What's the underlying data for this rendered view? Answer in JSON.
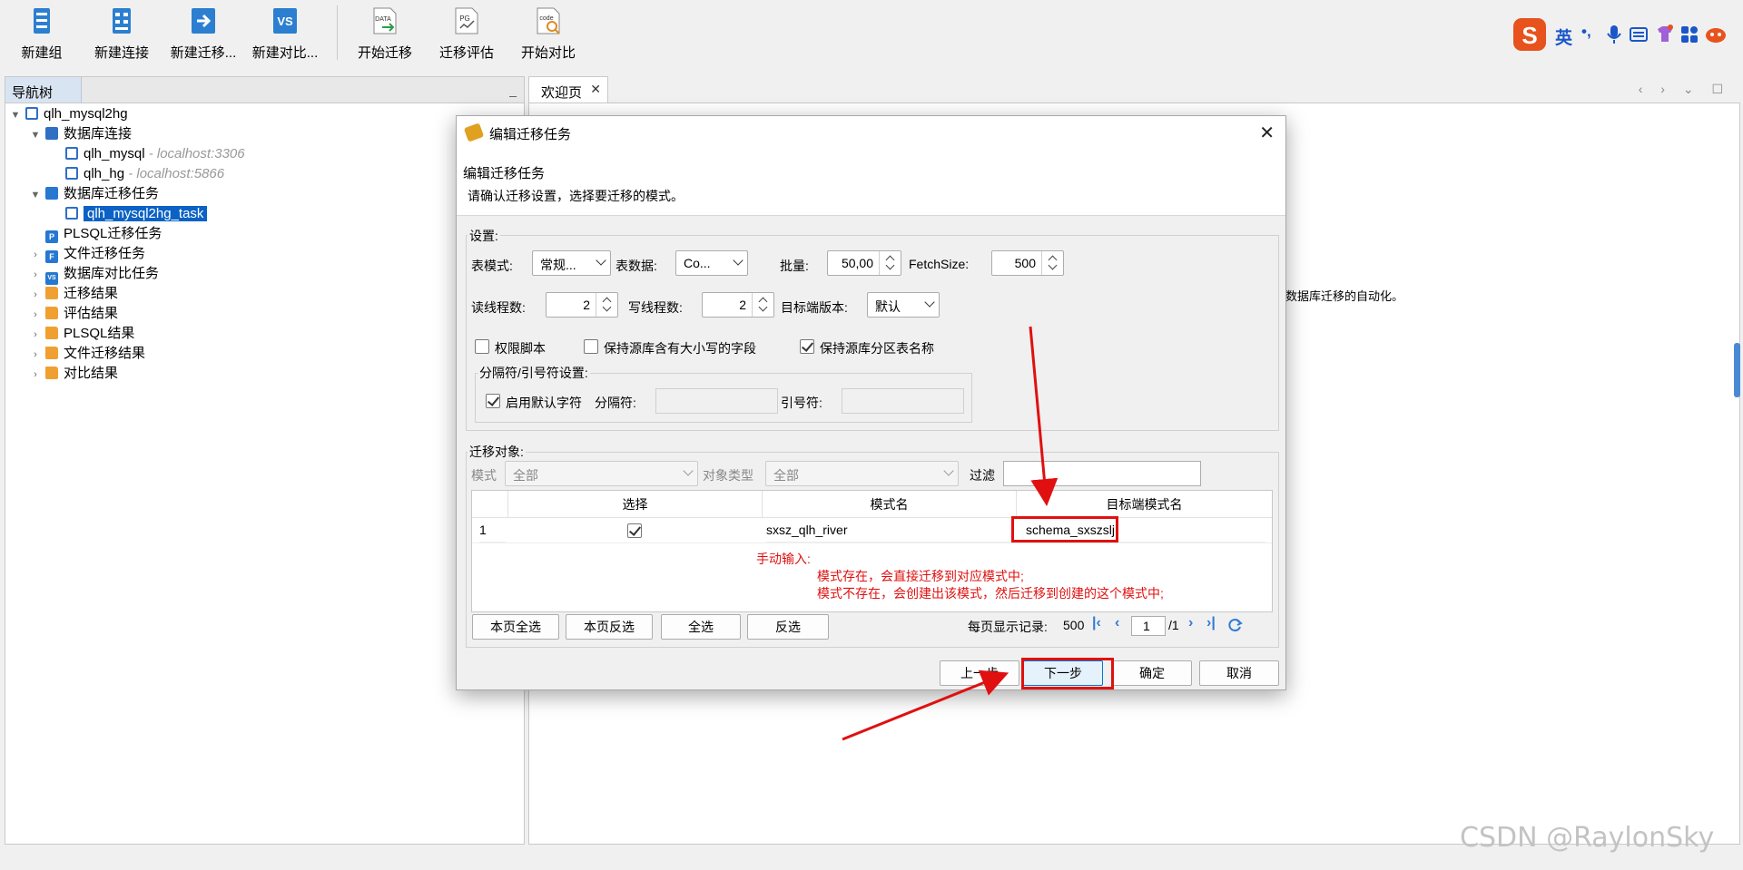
{
  "toolbar": {
    "buttons": [
      {
        "label": "新建组",
        "icon": "new-group-icon"
      },
      {
        "label": "新建连接",
        "icon": "new-connection-icon"
      },
      {
        "label": "新建迁移...",
        "icon": "new-migration-icon"
      },
      {
        "label": "新建对比...",
        "icon": "new-compare-icon"
      },
      {
        "label": "开始迁移",
        "icon": "start-migration-icon",
        "icon_text": "DATA"
      },
      {
        "label": "迁移评估",
        "icon": "migration-assessment-icon",
        "icon_text": "PG"
      },
      {
        "label": "开始对比",
        "icon": "start-compare-icon",
        "icon_text": "code"
      }
    ],
    "ime": {
      "lang": "英",
      "punct": "•,"
    }
  },
  "nav": {
    "tab_label": "导航树",
    "minimize": "_",
    "tree": {
      "root": "qlh_mysql2hg",
      "db_connections": "数据库连接",
      "conn1_name": "qlh_mysql",
      "conn1_host": "- localhost:3306",
      "conn2_name": "qlh_hg",
      "conn2_host": "- localhost:5866",
      "migration_tasks": "数据库迁移任务",
      "task_name": "qlh_mysql2hg_task",
      "plsql_tasks": "PLSQL迁移任务",
      "file_tasks": "文件迁移任务",
      "compare_tasks": "数据库对比任务",
      "migration_results": "迁移结果",
      "assessment_results": "评估结果",
      "plsql_results": "PLSQL结果",
      "file_results": "文件迁移结果",
      "compare_results": "对比结果"
    }
  },
  "editor": {
    "tab_label": "欢迎页",
    "tab_close": "✕",
    "nav_arrows": "‹ › ⌄ ☐",
    "welcome_fragment": "数据库迁移的自动化。"
  },
  "dialog": {
    "title": "编辑迁移任务",
    "close": "✕",
    "header_title": "编辑迁移任务",
    "header_desc": "请确认迁移设置，选择要迁移的模式。",
    "settings": {
      "group_label": "设置:",
      "table_mode_label": "表模式:",
      "table_mode_value": "常规...",
      "table_data_label": "表数据:",
      "table_data_value": "Co...",
      "batch_label": "批量:",
      "batch_value": "50,00",
      "fetchsize_label": "FetchSize:",
      "fetchsize_value": "500",
      "read_threads_label": "读线程数:",
      "read_threads_value": "2",
      "write_threads_label": "写线程数:",
      "write_threads_value": "2",
      "target_version_label": "目标端版本:",
      "target_version_value": "默认",
      "check_privilege_label": "权限脚本",
      "check_privilege": false,
      "check_case_label": "保持源库含有大小写的字段",
      "check_case": false,
      "check_partition_label": "保持源库分区表名称",
      "check_partition": true,
      "delimiter_group_label": "分隔符/引号符设置:",
      "default_char_label": "启用默认字符",
      "default_char": true,
      "delimiter_label": "分隔符:",
      "quote_label": "引号符:"
    },
    "objects": {
      "group_label": "迁移对象:",
      "schema_label": "模式",
      "schema_value": "全部",
      "type_label": "对象类型",
      "type_value": "全部",
      "filter_label": "过滤",
      "columns": [
        "选择",
        "模式名",
        "目标端模式名"
      ],
      "rows": [
        {
          "num": "1",
          "selected": true,
          "schema": "sxsz_qlh_river",
          "target": "schema_sxszslj"
        }
      ],
      "note_line1": "手动输入:",
      "note_line2": "模式存在，会直接迁移到对应模式中;",
      "note_line3": "模式不存在，会创建出该模式，然后迁移到创建的这个模式中;",
      "btn_page_select_all": "本页全选",
      "btn_page_invert": "本页反选",
      "btn_select_all": "全选",
      "btn_invert": "反选",
      "page_size_label": "每页显示记录:",
      "page_size": "500",
      "current_page": "1",
      "total_pages": "/1"
    },
    "buttons": {
      "prev": "上一步",
      "next": "下一步",
      "ok": "确定",
      "cancel": "取消"
    }
  },
  "watermark": "CSDN @RaylonSky",
  "annotation_color": "#e01010"
}
